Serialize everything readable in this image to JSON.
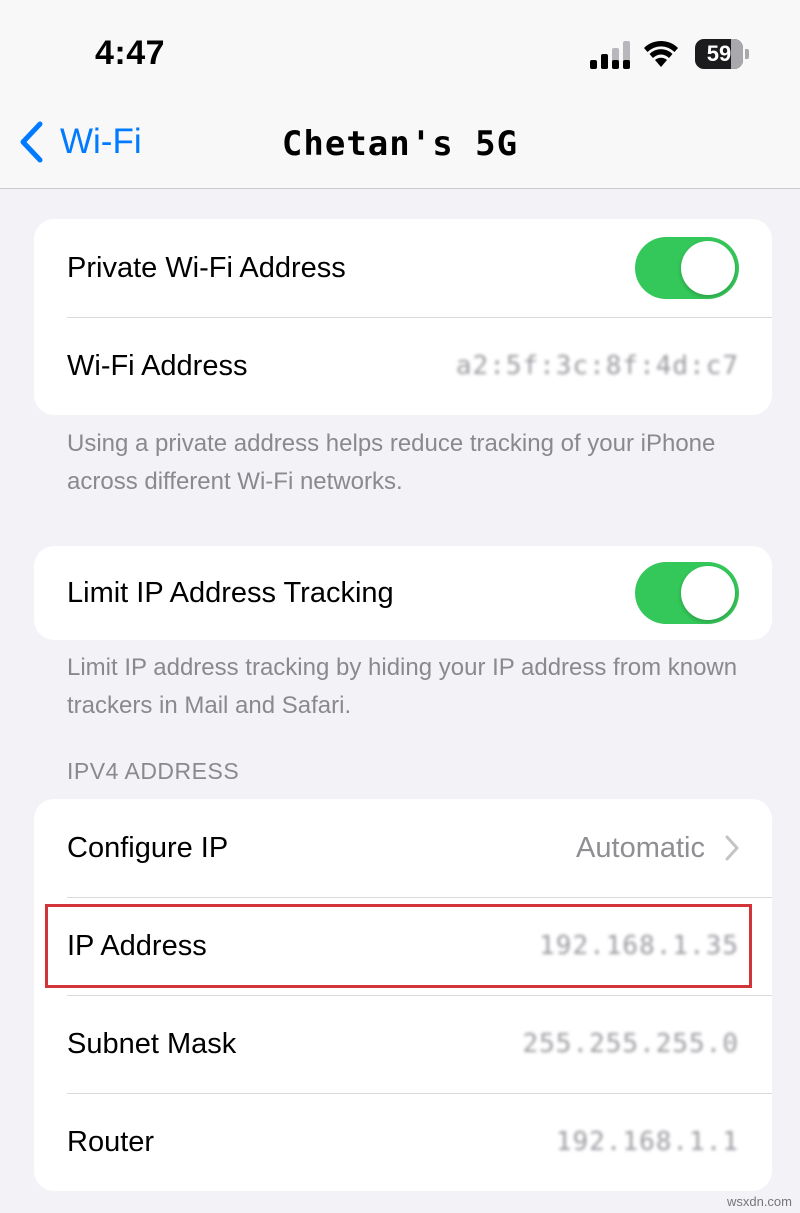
{
  "status_bar": {
    "time": "4:47",
    "battery": "59"
  },
  "nav": {
    "back_label": "Wi-Fi",
    "title": "Chetan's 5G"
  },
  "group1": {
    "private_address_label": "Private Wi-Fi Address",
    "private_address_enabled": true,
    "wifi_address_label": "Wi-Fi Address",
    "wifi_address_value": "a2:5f:3c:8f:4d:c7"
  },
  "footnote1": "Using a private address helps reduce tracking of your iPhone across different Wi-Fi networks.",
  "group2": {
    "limit_tracking_label": "Limit IP Address Tracking",
    "limit_tracking_enabled": true
  },
  "footnote2": "Limit IP address tracking by hiding your IP address from known trackers in Mail and Safari.",
  "ipv4_header": "IPV4 ADDRESS",
  "ipv4": {
    "configure_label": "Configure IP",
    "configure_value": "Automatic",
    "ip_label": "IP Address",
    "ip_value": "192.168.1.35",
    "subnet_label": "Subnet Mask",
    "subnet_value": "255.255.255.0",
    "router_label": "Router",
    "router_value": "192.168.1.1"
  },
  "watermark": "wsxdn.com",
  "colors": {
    "accent": "#007aff",
    "toggle_on": "#34c759",
    "highlight": "#d3343a"
  }
}
